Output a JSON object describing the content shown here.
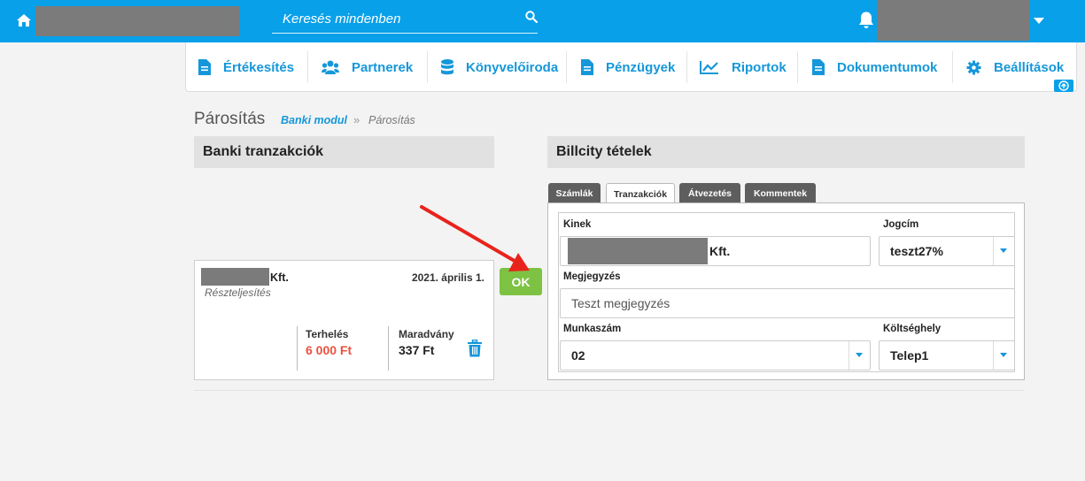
{
  "search": {
    "placeholder": "Keresés mindenben"
  },
  "nav": {
    "items": [
      {
        "label": "Értékesítés",
        "icon": "document-icon"
      },
      {
        "label": "Partnerek",
        "icon": "users-icon"
      },
      {
        "label": "Könyvelőiroda",
        "icon": "database-icon"
      },
      {
        "label": "Pénzügyek",
        "icon": "document-icon"
      },
      {
        "label": "Riportok",
        "icon": "chart-line-icon"
      },
      {
        "label": "Dokumentumok",
        "icon": "document-icon"
      },
      {
        "label": "Beállítások",
        "icon": "gear-icon"
      }
    ]
  },
  "breadcrumb": {
    "title": "Párosítás",
    "link": "Banki modul",
    "separator": "»",
    "current": "Párosítás"
  },
  "left_panel": {
    "title": "Banki tranzakciók",
    "transaction": {
      "name_suffix": "Kft.",
      "subtitle": "Részteljesítés",
      "date": "2021. április 1.",
      "charge_label": "Terhelés",
      "charge_value": "6 000 Ft",
      "remaining_label": "Maradvány",
      "remaining_value": "337 Ft"
    },
    "ok_label": "OK"
  },
  "right_panel": {
    "title": "Billcity tételek",
    "tabs": [
      "Számlák",
      "Tranzakciók",
      "Átvezetés",
      "Kommentek"
    ],
    "active_tab": "Tranzakciók",
    "form": {
      "kinek_label": "Kinek",
      "kinek_value": "Kft.",
      "jogcim_label": "Jogcím",
      "jogcim_value": "teszt27%",
      "megjegyzes_label": "Megjegyzés",
      "megjegyzes_value": "Teszt megjegyzés",
      "munkaszam_label": "Munkaszám",
      "munkaszam_value": "02",
      "koltseghely_label": "Költséghely",
      "koltseghely_value": "Telep1"
    }
  },
  "colors": {
    "brand": "#08a0e9",
    "link": "#1597d9",
    "ok": "#7dc243",
    "charge": "#e8523f"
  }
}
